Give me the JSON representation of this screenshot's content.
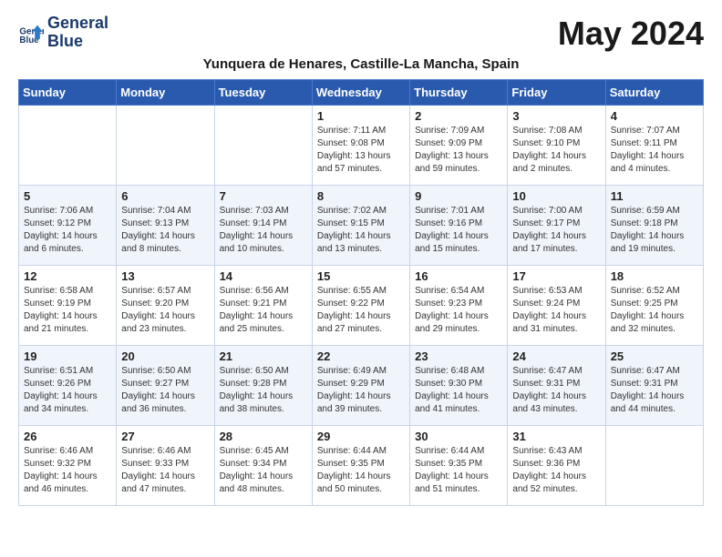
{
  "header": {
    "logo_line1": "General",
    "logo_line2": "Blue",
    "month": "May 2024",
    "location": "Yunquera de Henares, Castille-La Mancha, Spain"
  },
  "weekdays": [
    "Sunday",
    "Monday",
    "Tuesday",
    "Wednesday",
    "Thursday",
    "Friday",
    "Saturday"
  ],
  "weeks": [
    [
      {
        "day": "",
        "info": ""
      },
      {
        "day": "",
        "info": ""
      },
      {
        "day": "",
        "info": ""
      },
      {
        "day": "1",
        "info": "Sunrise: 7:11 AM\nSunset: 9:08 PM\nDaylight: 13 hours and 57 minutes."
      },
      {
        "day": "2",
        "info": "Sunrise: 7:09 AM\nSunset: 9:09 PM\nDaylight: 13 hours and 59 minutes."
      },
      {
        "day": "3",
        "info": "Sunrise: 7:08 AM\nSunset: 9:10 PM\nDaylight: 14 hours and 2 minutes."
      },
      {
        "day": "4",
        "info": "Sunrise: 7:07 AM\nSunset: 9:11 PM\nDaylight: 14 hours and 4 minutes."
      }
    ],
    [
      {
        "day": "5",
        "info": "Sunrise: 7:06 AM\nSunset: 9:12 PM\nDaylight: 14 hours and 6 minutes."
      },
      {
        "day": "6",
        "info": "Sunrise: 7:04 AM\nSunset: 9:13 PM\nDaylight: 14 hours and 8 minutes."
      },
      {
        "day": "7",
        "info": "Sunrise: 7:03 AM\nSunset: 9:14 PM\nDaylight: 14 hours and 10 minutes."
      },
      {
        "day": "8",
        "info": "Sunrise: 7:02 AM\nSunset: 9:15 PM\nDaylight: 14 hours and 13 minutes."
      },
      {
        "day": "9",
        "info": "Sunrise: 7:01 AM\nSunset: 9:16 PM\nDaylight: 14 hours and 15 minutes."
      },
      {
        "day": "10",
        "info": "Sunrise: 7:00 AM\nSunset: 9:17 PM\nDaylight: 14 hours and 17 minutes."
      },
      {
        "day": "11",
        "info": "Sunrise: 6:59 AM\nSunset: 9:18 PM\nDaylight: 14 hours and 19 minutes."
      }
    ],
    [
      {
        "day": "12",
        "info": "Sunrise: 6:58 AM\nSunset: 9:19 PM\nDaylight: 14 hours and 21 minutes."
      },
      {
        "day": "13",
        "info": "Sunrise: 6:57 AM\nSunset: 9:20 PM\nDaylight: 14 hours and 23 minutes."
      },
      {
        "day": "14",
        "info": "Sunrise: 6:56 AM\nSunset: 9:21 PM\nDaylight: 14 hours and 25 minutes."
      },
      {
        "day": "15",
        "info": "Sunrise: 6:55 AM\nSunset: 9:22 PM\nDaylight: 14 hours and 27 minutes."
      },
      {
        "day": "16",
        "info": "Sunrise: 6:54 AM\nSunset: 9:23 PM\nDaylight: 14 hours and 29 minutes."
      },
      {
        "day": "17",
        "info": "Sunrise: 6:53 AM\nSunset: 9:24 PM\nDaylight: 14 hours and 31 minutes."
      },
      {
        "day": "18",
        "info": "Sunrise: 6:52 AM\nSunset: 9:25 PM\nDaylight: 14 hours and 32 minutes."
      }
    ],
    [
      {
        "day": "19",
        "info": "Sunrise: 6:51 AM\nSunset: 9:26 PM\nDaylight: 14 hours and 34 minutes."
      },
      {
        "day": "20",
        "info": "Sunrise: 6:50 AM\nSunset: 9:27 PM\nDaylight: 14 hours and 36 minutes."
      },
      {
        "day": "21",
        "info": "Sunrise: 6:50 AM\nSunset: 9:28 PM\nDaylight: 14 hours and 38 minutes."
      },
      {
        "day": "22",
        "info": "Sunrise: 6:49 AM\nSunset: 9:29 PM\nDaylight: 14 hours and 39 minutes."
      },
      {
        "day": "23",
        "info": "Sunrise: 6:48 AM\nSunset: 9:30 PM\nDaylight: 14 hours and 41 minutes."
      },
      {
        "day": "24",
        "info": "Sunrise: 6:47 AM\nSunset: 9:31 PM\nDaylight: 14 hours and 43 minutes."
      },
      {
        "day": "25",
        "info": "Sunrise: 6:47 AM\nSunset: 9:31 PM\nDaylight: 14 hours and 44 minutes."
      }
    ],
    [
      {
        "day": "26",
        "info": "Sunrise: 6:46 AM\nSunset: 9:32 PM\nDaylight: 14 hours and 46 minutes."
      },
      {
        "day": "27",
        "info": "Sunrise: 6:46 AM\nSunset: 9:33 PM\nDaylight: 14 hours and 47 minutes."
      },
      {
        "day": "28",
        "info": "Sunrise: 6:45 AM\nSunset: 9:34 PM\nDaylight: 14 hours and 48 minutes."
      },
      {
        "day": "29",
        "info": "Sunrise: 6:44 AM\nSunset: 9:35 PM\nDaylight: 14 hours and 50 minutes."
      },
      {
        "day": "30",
        "info": "Sunrise: 6:44 AM\nSunset: 9:35 PM\nDaylight: 14 hours and 51 minutes."
      },
      {
        "day": "31",
        "info": "Sunrise: 6:43 AM\nSunset: 9:36 PM\nDaylight: 14 hours and 52 minutes."
      },
      {
        "day": "",
        "info": ""
      }
    ]
  ]
}
